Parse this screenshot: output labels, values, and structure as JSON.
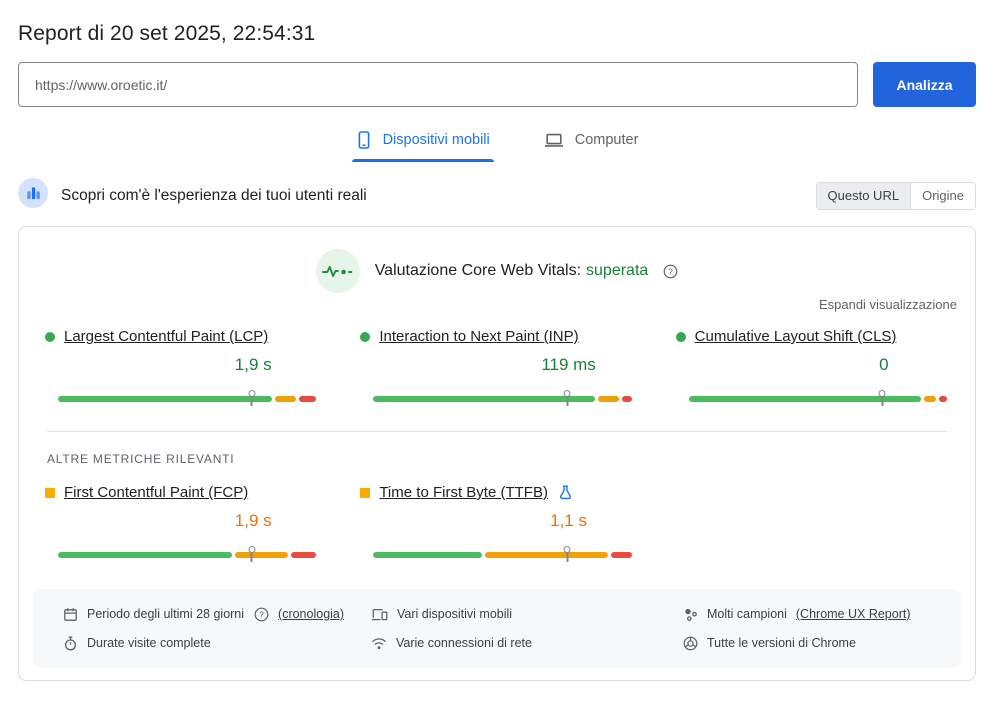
{
  "header": {
    "title": "Report di 20 set 2025, 22:54:31"
  },
  "search": {
    "url": "https://www.oroetic.it/",
    "analyze_label": "Analizza"
  },
  "tabs": [
    {
      "id": "mobile",
      "label": "Dispositivi mobili",
      "icon": "phone",
      "active": true
    },
    {
      "id": "desktop",
      "label": "Computer",
      "icon": "laptop",
      "active": false
    }
  ],
  "field_section": {
    "heading": "Scopri com'è l'esperienza dei tuoi utenti reali",
    "toggle": {
      "this_url": "Questo URL",
      "origin": "Origine"
    },
    "cwv_title": "Valutazione Core Web Vitals:",
    "cwv_status": "superata",
    "expand_label": "Espandi visualizzazione",
    "other_metrics_label": "ALTRE METRICHE RILEVANTI"
  },
  "metrics": {
    "core": [
      {
        "id": "lcp",
        "label": "Largest Contentful Paint (LCP)",
        "value": "1,9 s",
        "status": "good",
        "distribution": {
          "good": 85,
          "needs_improvement": 8,
          "poor": 7
        },
        "marker_percent": 75,
        "experimental": false
      },
      {
        "id": "inp",
        "label": "Interaction to Next Paint (INP)",
        "value": "119 ms",
        "status": "good",
        "distribution": {
          "good": 88,
          "needs_improvement": 8,
          "poor": 4
        },
        "marker_percent": 75,
        "experimental": false
      },
      {
        "id": "cls",
        "label": "Cumulative Layout Shift (CLS)",
        "value": "0",
        "status": "good",
        "distribution": {
          "good": 92,
          "needs_improvement": 5,
          "poor": 3
        },
        "marker_percent": 75,
        "experimental": false
      }
    ],
    "other": [
      {
        "id": "fcp",
        "label": "First Contentful Paint (FCP)",
        "value": "1,9 s",
        "status": "average",
        "distribution": {
          "good": 69,
          "needs_improvement": 21,
          "poor": 10
        },
        "marker_percent": 75,
        "experimental": false
      },
      {
        "id": "ttfb",
        "label": "Time to First Byte (TTFB)",
        "value": "1,1 s",
        "status": "average",
        "distribution": {
          "good": 43,
          "needs_improvement": 49,
          "poor": 8
        },
        "marker_percent": 75,
        "experimental": true
      }
    ]
  },
  "footer": {
    "items": [
      {
        "name": "period",
        "icon": "calendar",
        "text": "Periodo degli ultimi 28 giorni",
        "help": true,
        "link": "(cronologia)"
      },
      {
        "name": "devices",
        "icon": "devices",
        "text": "Vari dispositivi mobili",
        "help": false,
        "link": ""
      },
      {
        "name": "samples",
        "icon": "samples",
        "text": "Molti campioni",
        "help": false,
        "link": "(Chrome UX Report)"
      },
      {
        "name": "visit-durations",
        "icon": "stopwatch",
        "text": "Durate visite complete",
        "help": false,
        "link": ""
      },
      {
        "name": "connections",
        "icon": "wifi",
        "text": "Varie connessioni di rete",
        "help": false,
        "link": ""
      },
      {
        "name": "chrome-versions",
        "icon": "chrome",
        "text": "Tutte le versioni di Chrome",
        "help": false,
        "link": ""
      }
    ]
  },
  "colors": {
    "accent_blue": "#2264dc",
    "tab_blue": "#1a73e8",
    "good_green": "#188038",
    "bar_green": "#4cbb5f",
    "bar_orange": "#f1a106",
    "bar_red": "#ec4a41",
    "average_orange": "#e8710a"
  }
}
